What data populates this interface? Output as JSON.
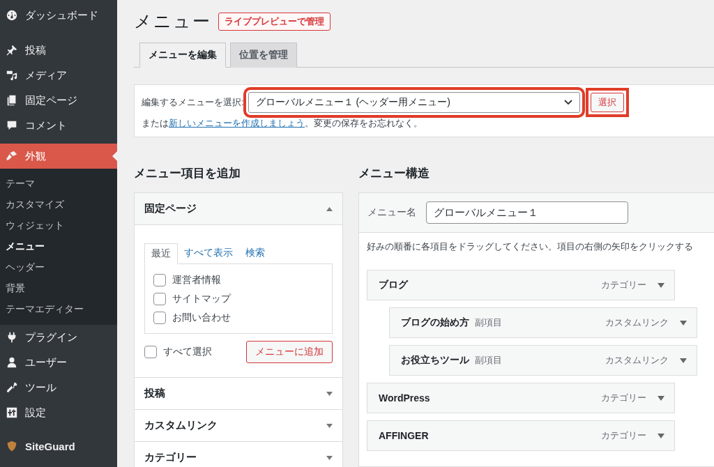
{
  "sidebar": {
    "items": [
      {
        "label": "ダッシュボード",
        "selected": false
      },
      {
        "label": "投稿",
        "selected": false
      },
      {
        "label": "メディア",
        "selected": false
      },
      {
        "label": "固定ページ",
        "selected": false
      },
      {
        "label": "コメント",
        "selected": false
      },
      {
        "label": "外観",
        "selected": true,
        "children": [
          {
            "label": "テーマ",
            "selected": false
          },
          {
            "label": "カスタマイズ",
            "selected": false
          },
          {
            "label": "ウィジェット",
            "selected": false
          },
          {
            "label": "メニュー",
            "selected": true
          },
          {
            "label": "ヘッダー",
            "selected": false
          },
          {
            "label": "背景",
            "selected": false
          },
          {
            "label": "テーマエディター",
            "selected": false
          }
        ]
      },
      {
        "label": "プラグイン",
        "selected": false
      },
      {
        "label": "ユーザー",
        "selected": false
      },
      {
        "label": "ツール",
        "selected": false
      },
      {
        "label": "設定",
        "selected": false
      },
      {
        "label": "SiteGuard",
        "selected": false
      }
    ]
  },
  "page": {
    "title": "メニュー",
    "action": "ライブプレビューで管理"
  },
  "tabs": [
    {
      "label": "メニューを編集",
      "selected": true
    },
    {
      "label": "位置を管理",
      "selected": false
    }
  ],
  "menu_select": {
    "label": "編集するメニューを選択:",
    "value": "グローバルメニュー１ (ヘッダー用メニュー)",
    "highlighted": true,
    "button": "選択",
    "button_highlighted": true,
    "note_before": "または",
    "note_link": "新しいメニューを作成しましょう",
    "note_after": "。変更の保存をお忘れなく。"
  },
  "add_items": {
    "heading": "メニュー項目を追加",
    "sections": [
      {
        "title": "固定ページ",
        "expanded": true,
        "tabs": [
          {
            "label": "最近",
            "selected": true
          },
          {
            "label": "すべて表示",
            "selected": false
          },
          {
            "label": "検索",
            "selected": false
          }
        ],
        "pages": [
          {
            "label": "運営者情報",
            "checked": false
          },
          {
            "label": "サイトマップ",
            "checked": false
          },
          {
            "label": "お問い合わせ",
            "checked": false
          }
        ],
        "select_all": {
          "label": "すべて選択",
          "checked": false
        },
        "button": "メニューに追加"
      },
      {
        "title": "投稿",
        "expanded": false
      },
      {
        "title": "カスタムリンク",
        "expanded": false
      },
      {
        "title": "カテゴリー",
        "expanded": false
      }
    ]
  },
  "structure": {
    "heading": "メニュー構造",
    "name_label": "メニュー名",
    "name_value": "グローバルメニュー１",
    "instructions": "好みの順番に各項目をドラッグしてください。項目の右側の矢印をクリックする",
    "items": [
      {
        "title": "ブログ",
        "type": "カテゴリー",
        "children": [
          {
            "title": "ブログの始め方",
            "sub": "副項目",
            "type": "カスタムリンク"
          },
          {
            "title": "お役立ちツール",
            "sub": "副項目",
            "type": "カスタムリンク"
          }
        ]
      },
      {
        "title": "WordPress",
        "type": "カテゴリー"
      },
      {
        "title": "AFFINGER",
        "type": "カテゴリー"
      }
    ]
  }
}
